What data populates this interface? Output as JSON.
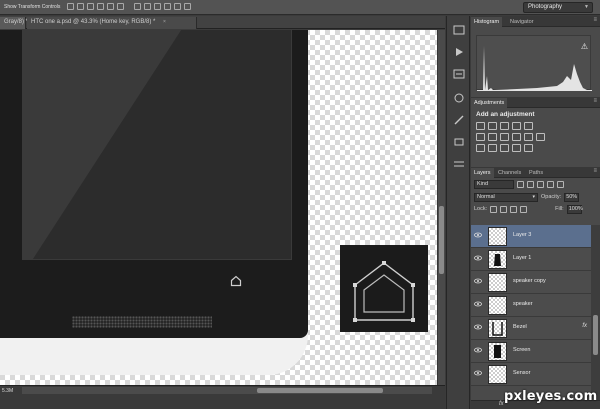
{
  "options_bar": {
    "show_transform_label": "Show Transform Controls",
    "workspace": "Photography"
  },
  "tabs": [
    {
      "label": "Gray/8) *",
      "close": "×"
    },
    {
      "label": "HTC one a.psd @ 43.3% (Home key, RGB/8) *",
      "close": "×"
    }
  ],
  "status": {
    "zoom": "5.3M"
  },
  "panels": {
    "histogram_tabs": [
      "Histogram",
      "Navigator"
    ],
    "adjustments_tab": "Adjustments",
    "adjustments_title": "Add an adjustment",
    "layers_tabs": [
      "Layers",
      "Channels",
      "Paths"
    ],
    "kind_filter": "Kind",
    "blend_mode": "Normal",
    "opacity_label": "Opacity:",
    "opacity_value": "50%",
    "lock_label": "Lock:",
    "fill_label": "Fill:",
    "fill_value": "100%",
    "layers": [
      {
        "name": "Layer 3",
        "selected": true,
        "fx": false
      },
      {
        "name": "Layer 1",
        "selected": false,
        "fx": false
      },
      {
        "name": "speaker copy",
        "selected": false,
        "fx": false
      },
      {
        "name": "speaker",
        "selected": false,
        "fx": false
      },
      {
        "name": "Bezel",
        "selected": false,
        "fx": true
      },
      {
        "name": "Screen",
        "selected": false,
        "fx": false
      },
      {
        "name": "Sensor",
        "selected": false,
        "fx": false
      }
    ],
    "fx_symbol": "fx"
  },
  "watermark": "pxleyes.com",
  "colors": {
    "selection": "#5b6f8e",
    "panel_bg": "#4a4a4a",
    "phone_body": "#1c1c1c"
  }
}
